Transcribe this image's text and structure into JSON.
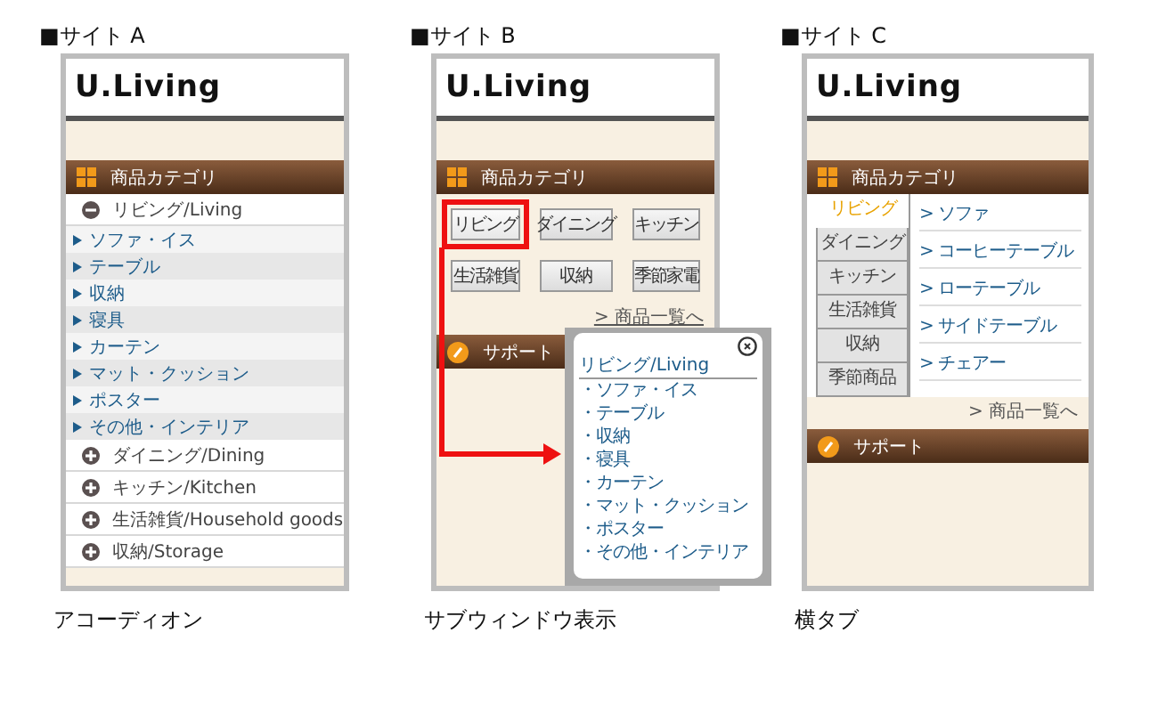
{
  "panels": [
    {
      "kind": "accordion",
      "heading": "■サイト A",
      "logo": "U.Living",
      "category_title": "商品カテゴリ",
      "groups": [
        {
          "label": "リビング/Living",
          "expanded": true,
          "children": [
            {
              "label": "ソファ・イス"
            },
            {
              "label": "テーブル"
            },
            {
              "label": "収納"
            },
            {
              "label": "寝具"
            },
            {
              "label": "カーテン"
            },
            {
              "label": "マット・クッション"
            },
            {
              "label": "ポスター"
            },
            {
              "label": "その他・インテリア"
            }
          ]
        },
        {
          "label": "ダイニング/Dining",
          "expanded": false
        },
        {
          "label": "キッチン/Kitchen",
          "expanded": false
        },
        {
          "label": "生活雑貨/Household goods",
          "expanded": false
        },
        {
          "label": "収納/Storage",
          "expanded": false
        }
      ],
      "caption": "アコーディオン"
    },
    {
      "kind": "subwindow",
      "heading": "■サイト B",
      "logo": "U.Living",
      "category_title": "商品カテゴリ",
      "buttons": [
        {
          "label": "リビング",
          "selected": true
        },
        {
          "label": "ダイニング",
          "selected": false
        },
        {
          "label": "キッチン",
          "selected": false
        },
        {
          "label": "生活雑貨",
          "selected": false
        },
        {
          "label": "収納",
          "selected": false
        },
        {
          "label": "季節家電",
          "selected": false
        }
      ],
      "list_link": "> 商品一覧へ",
      "support_title": "サポート",
      "subwindow": {
        "title": "リビング/Living",
        "items": [
          "・ソファ・イス",
          "・テーブル",
          "・収納",
          "・寝具",
          "・カーテン",
          "・マット・クッション",
          "・ポスター",
          "・その他・インテリア"
        ]
      },
      "caption": "サブウィンドウ表示"
    },
    {
      "kind": "tabs",
      "heading": "■サイト C",
      "logo": "U.Living",
      "category_title": "商品カテゴリ",
      "tabs": [
        {
          "label": "リビング",
          "selected": true
        },
        {
          "label": "ダイニング",
          "selected": false
        },
        {
          "label": "キッチン",
          "selected": false
        },
        {
          "label": "生活雑貨",
          "selected": false
        },
        {
          "label": "収納",
          "selected": false
        },
        {
          "label": "季節商品",
          "selected": false
        }
      ],
      "items": [
        "> ソファ",
        "> コーヒーテーブル",
        "> ローテーブル",
        "> サイドテーブル",
        "> チェアー"
      ],
      "list_link": "> 商品一覧へ",
      "support_title": "サポート",
      "caption": "横タブ"
    }
  ]
}
